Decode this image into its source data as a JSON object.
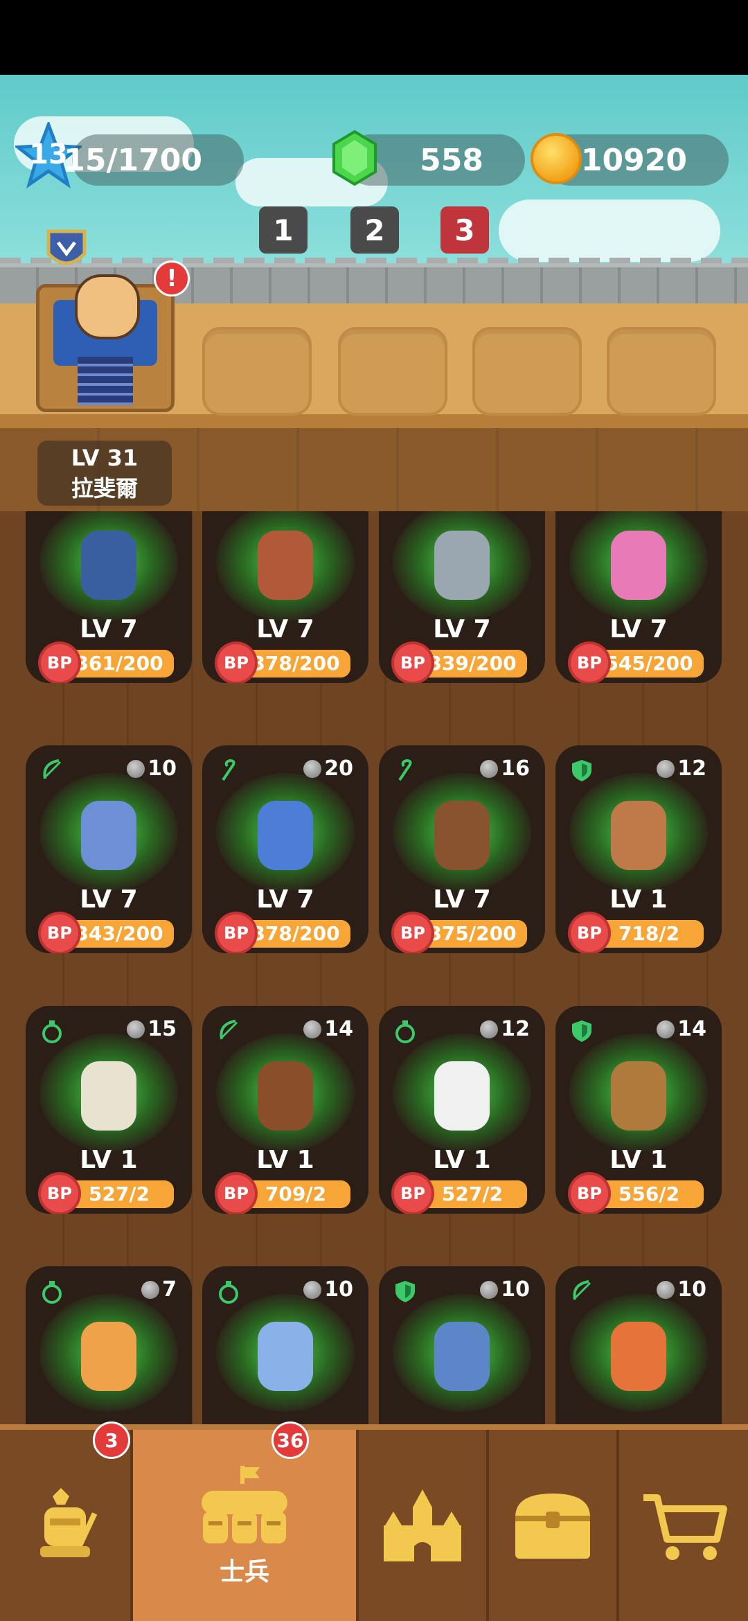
{
  "header": {
    "level": "13",
    "xp": "15/1700",
    "gems": "558",
    "coins": "10920",
    "pages": [
      {
        "label": "1",
        "color": "#4a4a4a"
      },
      {
        "label": "2",
        "color": "#4a4a4a"
      },
      {
        "label": "3",
        "color": "#c0343b"
      }
    ],
    "alert": "!"
  },
  "hero": {
    "level": "LV 31",
    "name": "拉斐爾"
  },
  "cards": [
    {
      "icon": "",
      "cost": "",
      "level": "LV 7",
      "bp": "361/200",
      "bp_fill": 1.0,
      "color": "#3a5fa0"
    },
    {
      "icon": "",
      "cost": "",
      "level": "LV 7",
      "bp": "378/200",
      "bp_fill": 1.0,
      "color": "#b25a38"
    },
    {
      "icon": "",
      "cost": "",
      "level": "LV 7",
      "bp": "339/200",
      "bp_fill": 1.0,
      "color": "#9aa6b0"
    },
    {
      "icon": "",
      "cost": "",
      "level": "LV 7",
      "bp": "545/200",
      "bp_fill": 1.0,
      "color": "#e87ab8"
    },
    {
      "icon": "bow",
      "cost": "10",
      "level": "LV 7",
      "bp": "343/200",
      "bp_fill": 1.0,
      "color": "#6c8fd6"
    },
    {
      "icon": "staff",
      "cost": "20",
      "level": "LV 7",
      "bp": "378/200",
      "bp_fill": 1.0,
      "color": "#4c7ed8"
    },
    {
      "icon": "staff",
      "cost": "16",
      "level": "LV 7",
      "bp": "375/200",
      "bp_fill": 1.0,
      "color": "#8a5330"
    },
    {
      "icon": "shield",
      "cost": "12",
      "level": "LV 1",
      "bp": "718/2",
      "bp_fill": 1.0,
      "color": "#c07a4a"
    },
    {
      "icon": "potion",
      "cost": "15",
      "level": "LV 1",
      "bp": "527/2",
      "bp_fill": 1.0,
      "color": "#e8e2d0"
    },
    {
      "icon": "bow",
      "cost": "14",
      "level": "LV 1",
      "bp": "709/2",
      "bp_fill": 1.0,
      "color": "#8a4e2a"
    },
    {
      "icon": "potion",
      "cost": "12",
      "level": "LV 1",
      "bp": "527/2",
      "bp_fill": 1.0,
      "color": "#f0f0f0"
    },
    {
      "icon": "shield",
      "cost": "14",
      "level": "LV 1",
      "bp": "556/2",
      "bp_fill": 1.0,
      "color": "#b07a3c"
    },
    {
      "icon": "potion",
      "cost": "7",
      "level": "",
      "bp": "",
      "bp_fill": 0,
      "color": "#f0a24a"
    },
    {
      "icon": "potion",
      "cost": "10",
      "level": "",
      "bp": "",
      "bp_fill": 0,
      "color": "#8ab2e8"
    },
    {
      "icon": "shield",
      "cost": "10",
      "level": "",
      "bp": "",
      "bp_fill": 0,
      "color": "#5c86c8"
    },
    {
      "icon": "bow",
      "cost": "10",
      "level": "",
      "bp": "",
      "bp_fill": 0,
      "color": "#e6733a"
    }
  ],
  "nav": {
    "tabs": [
      {
        "icon": "hero-icon",
        "label": "",
        "badge": "3"
      },
      {
        "icon": "soldiers-icon",
        "label": "士兵",
        "badge": "36"
      },
      {
        "icon": "castle-icon",
        "label": "",
        "badge": ""
      },
      {
        "icon": "chest-icon",
        "label": "",
        "badge": ""
      },
      {
        "icon": "cart-icon",
        "label": "",
        "badge": ""
      }
    ]
  },
  "colors": {
    "accent": "#d9894a",
    "bp_red": "#e94b4b",
    "glow": "#50dc50"
  }
}
